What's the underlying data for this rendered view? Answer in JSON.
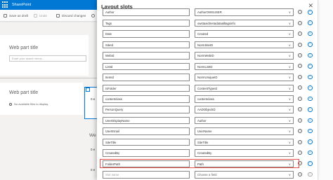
{
  "suite": {
    "title": "SharePoint"
  },
  "commandbar": {
    "save_draft": "Save as draft",
    "undo": "Undo",
    "discard": "Discard changes"
  },
  "canvas": {
    "webpart1_title": "Web part title",
    "search_placeholder": "Enter your search terms...",
    "webpart2_title": "Web part title",
    "no_results": "No available files to display.",
    "fragment_a": "0 e",
    "fragment_b": "We",
    "fragment_c": "0 e",
    "fragment_d": "0 e"
  },
  "panel": {
    "title": "Layout slots",
    "rows": [
      {
        "slot": "Author",
        "property": "AuthorOWSUSER",
        "property_placeholder": false,
        "slot_placeholder": false,
        "highlighted": false
      },
      {
        "slot": "Tags",
        "property": "owstaxidmetadataalltagsinfo",
        "property_placeholder": false,
        "slot_placeholder": false,
        "highlighted": false
      },
      {
        "slot": "Date",
        "property": "Created",
        "property_placeholder": false,
        "slot_placeholder": false,
        "highlighted": false
      },
      {
        "slot": "SiteId",
        "property": "NormSiteID",
        "property_placeholder": false,
        "slot_placeholder": false,
        "highlighted": false
      },
      {
        "slot": "WebId",
        "property": "NormWebID",
        "property_placeholder": false,
        "slot_placeholder": false,
        "highlighted": false
      },
      {
        "slot": "ListId",
        "property": "NormListID",
        "property_placeholder": false,
        "slot_placeholder": false,
        "highlighted": false
      },
      {
        "slot": "ItemId",
        "property": "NormUniqueID",
        "property_placeholder": false,
        "slot_placeholder": false,
        "highlighted": false
      },
      {
        "slot": "IsFolder",
        "property": "ContentTypeId",
        "property_placeholder": false,
        "slot_placeholder": false,
        "highlighted": false
      },
      {
        "slot": "contentclass",
        "property": "contentclass",
        "property_placeholder": false,
        "slot_placeholder": false,
        "highlighted": false
      },
      {
        "slot": "PersonQuery",
        "property": "AADObjectID",
        "property_placeholder": false,
        "slot_placeholder": false,
        "highlighted": false
      },
      {
        "slot": "UserDisplayName",
        "property": "Author",
        "property_placeholder": false,
        "slot_placeholder": false,
        "highlighted": false
      },
      {
        "slot": "UserEmail",
        "property": "UserName",
        "property_placeholder": false,
        "slot_placeholder": false,
        "highlighted": false
      },
      {
        "slot": "SiteTitle",
        "property": "SiteTitle",
        "property_placeholder": false,
        "slot_placeholder": false,
        "highlighted": false
      },
      {
        "slot": "CreatedBy",
        "property": "CreatedBy",
        "property_placeholder": false,
        "slot_placeholder": false,
        "highlighted": false
      },
      {
        "slot": "FolderPath",
        "property": "Path",
        "property_placeholder": false,
        "slot_placeholder": false,
        "highlighted": true
      },
      {
        "slot": "Slot name",
        "property": "Choose a field",
        "property_placeholder": true,
        "slot_placeholder": true,
        "highlighted": false
      }
    ]
  },
  "colors": {
    "accent": "#0078d4",
    "highlight": "#e8504c"
  }
}
